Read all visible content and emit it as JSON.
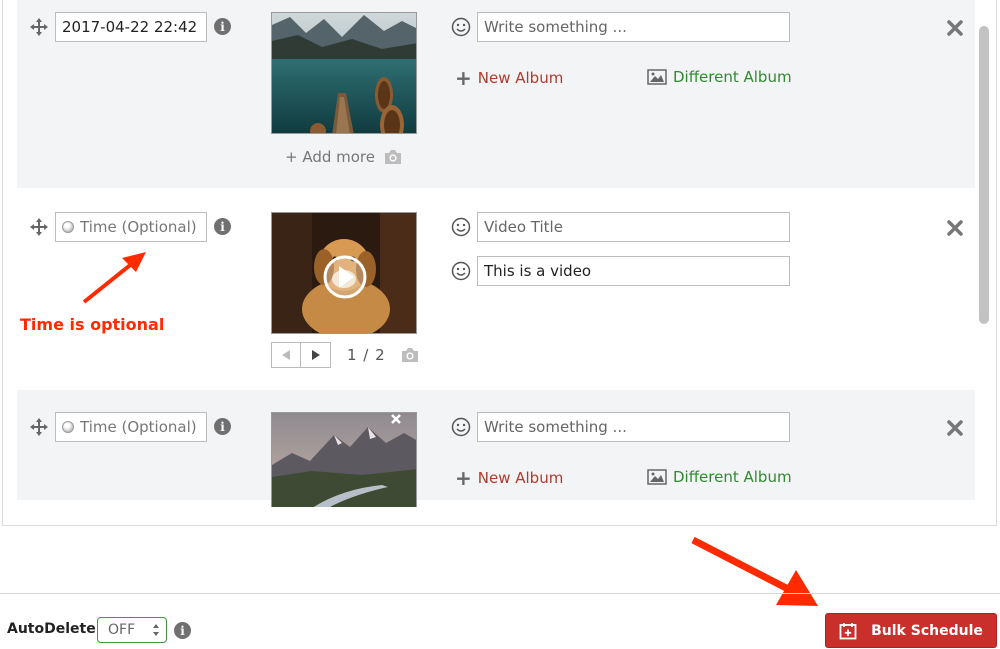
{
  "posts": [
    {
      "time": "2017-04-22 22:42",
      "caption_placeholder": "Write something ...",
      "new_album": "New Album",
      "different_album": "Different Album",
      "add_more": "+ Add more"
    },
    {
      "time_placeholder": "Time (Optional)",
      "video_title_placeholder": "Video Title",
      "description_value": "This is a video",
      "pager": "1 / 2"
    },
    {
      "time_placeholder": "Time (Optional)",
      "caption_placeholder": "Write something ...",
      "new_album": "New Album",
      "different_album": "Different Album"
    }
  ],
  "annotation": {
    "note": "Time is optional"
  },
  "footer": {
    "autodelete_label": "AutoDelete",
    "autodelete_value": "OFF",
    "bulk_schedule": "Bulk Schedule"
  },
  "icons": [
    "move-icon",
    "info-icon",
    "smiley-icon",
    "remove-icon",
    "plus-icon",
    "image-icon",
    "camera-icon",
    "play-icon",
    "calendar-plus-icon"
  ],
  "colors": {
    "accent": "#c9302c",
    "new_album": "#b23a2e",
    "different_album": "#2f8a2f",
    "annotation": "#ff2a00"
  }
}
